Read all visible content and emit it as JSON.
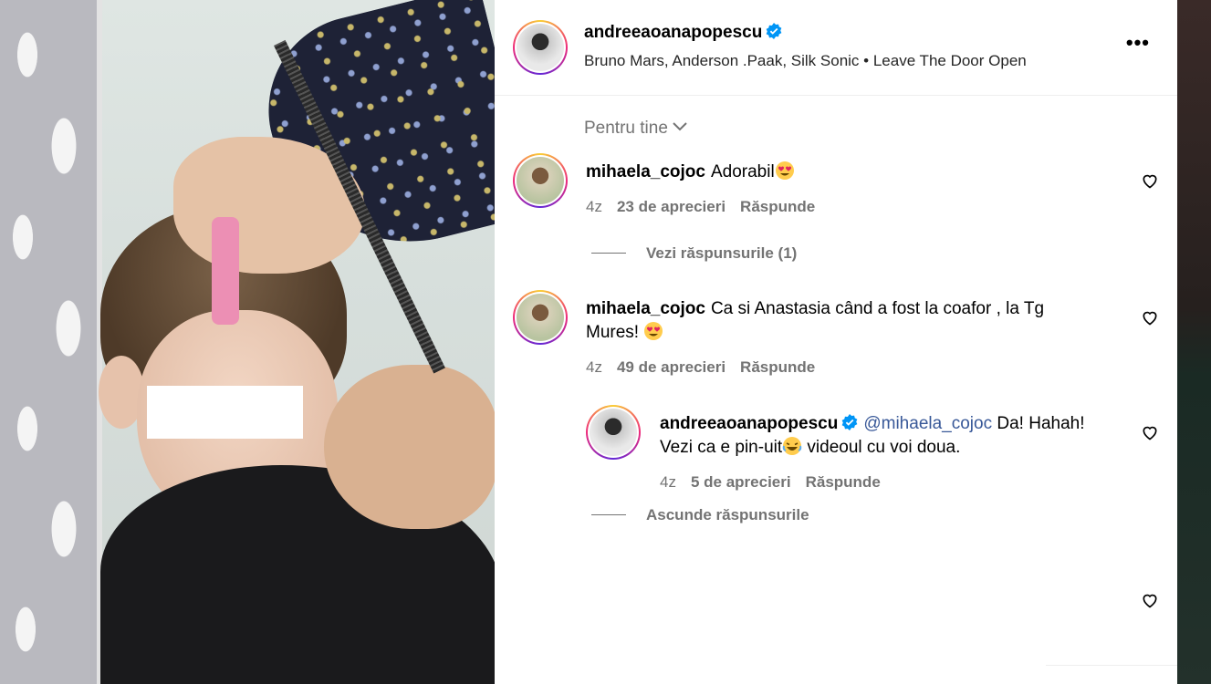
{
  "post": {
    "author": "andreeaoanapopescu",
    "music": "Bruno Mars, Anderson .Paak, Silk Sonic • Leave The Door Open",
    "more_label": "•••"
  },
  "sort": {
    "label": "Pentru tine"
  },
  "comments": [
    {
      "user": "mihaela_cojoc",
      "text": "Adorabil",
      "emoji": "heart-eyes-emoji",
      "age": "4z",
      "likes": "23 de aprecieri",
      "reply_label": "Răspunde",
      "replies_toggle": "Vezi răspunsurile (1)"
    },
    {
      "user": "mihaela_cojoc",
      "text_line1": "Ca si Anastasia când a fost la coafor , la Tg",
      "text_line2": "Mures!",
      "emoji": "heart-eyes-emoji",
      "age": "4z",
      "likes": "49 de aprecieri",
      "reply_label": "Răspunde",
      "replies": [
        {
          "user": "andreeaoanapopescu",
          "mention": "@mihaela_cojoc",
          "text_part1": "Da! Hahah!",
          "text_line2a": "Vezi ca e pin-uit",
          "emoji": "laughing-emoji",
          "text_line2b": " videoul cu voi doua.",
          "age": "4z",
          "likes": "5 de aprecieri",
          "reply_label": "Răspunde"
        }
      ],
      "replies_toggle": "Ascunde răspunsurile"
    }
  ],
  "colors": {
    "meta_text": "#737373",
    "mention": "#385898",
    "verified": "#0095f6"
  }
}
